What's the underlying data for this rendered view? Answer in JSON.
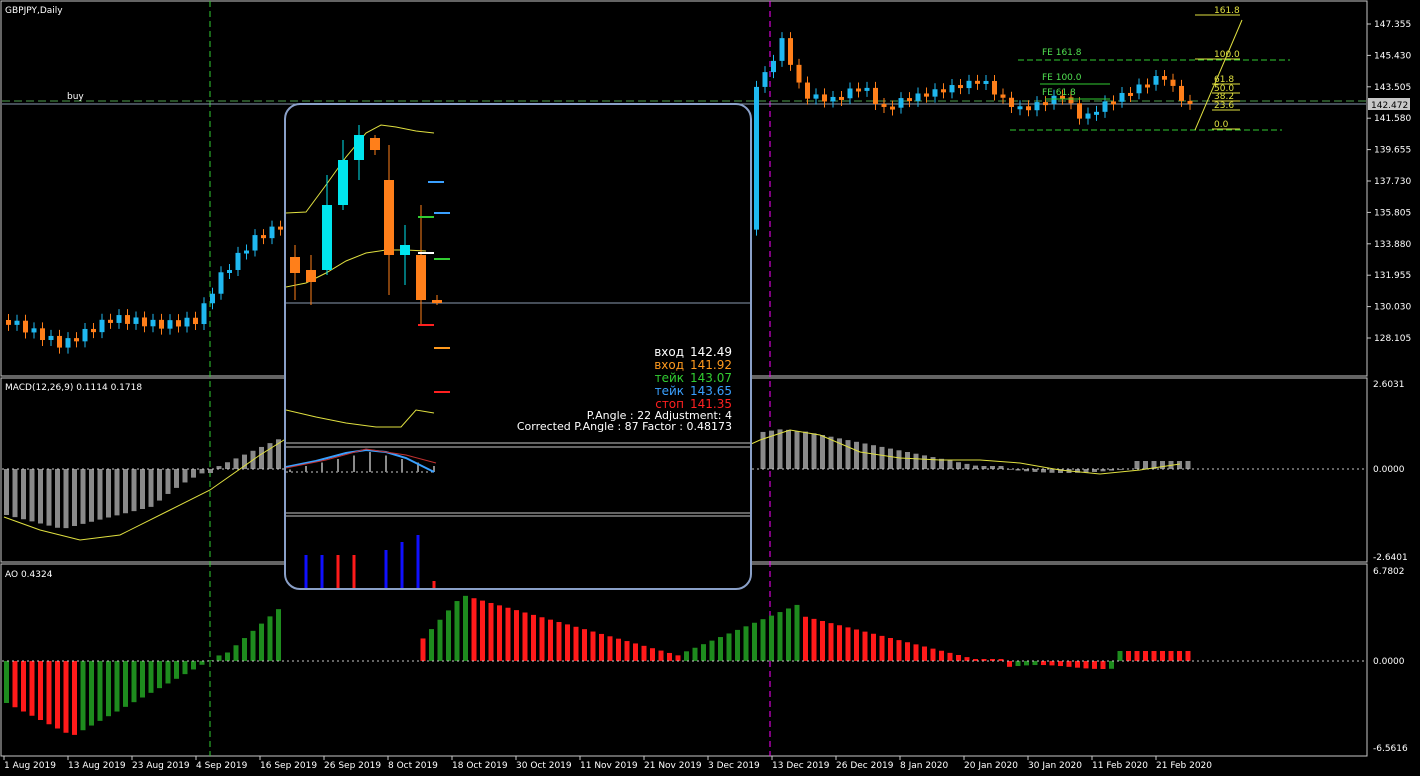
{
  "symbol_title": "GBPJPY,Daily",
  "buy_label": "buy",
  "price_axis": [
    "147.355",
    "145.430",
    "143.505",
    "141.580",
    "139.655",
    "137.730",
    "135.805",
    "133.880",
    "131.955",
    "130.030",
    "128.105"
  ],
  "current_price": "142.472",
  "macd": {
    "label": "MACD(12,26,9) 0.1114 0.1718",
    "axis_top": "2.6031",
    "axis_zero": "0.0000",
    "axis_bottom": "-2.6401"
  },
  "ao": {
    "label": "AO 0.4324",
    "axis_top": "6.7802",
    "axis_zero": "0.0000",
    "axis_bottom": "-6.5616"
  },
  "dates": [
    "1 Aug 2019",
    "13 Aug 2019",
    "23 Aug 2019",
    "4 Sep 2019",
    "16 Sep 2019",
    "26 Sep 2019",
    "8 Oct 2019",
    "18 Oct 2019",
    "30 Oct 2019",
    "11 Nov 2019",
    "21 Nov 2019",
    "3 Dec 2019",
    "13 Dec 2019",
    "26 Dec 2019",
    "8 Jan 2020",
    "20 Jan 2020",
    "30 Jan 2020",
    "11 Feb 2020",
    "21 Feb 2020"
  ],
  "fibo": {
    "fe_labels": [
      "FE 161.8",
      "FE 100.0",
      "FE 61.8"
    ],
    "levels": [
      "161.8",
      "100.0",
      "61.8",
      "50.0",
      "38.2",
      "23.6",
      "0.0"
    ]
  },
  "panel": {
    "lines": [
      {
        "label": "вход",
        "value": "142.49",
        "color": "#ffffff"
      },
      {
        "label": "вход",
        "value": "141.92",
        "color": "#ff9a1e"
      },
      {
        "label": "тейк",
        "value": "143.07",
        "color": "#32cd32"
      },
      {
        "label": "тейк",
        "value": "143.65",
        "color": "#3aa0ff"
      },
      {
        "label": "стоп",
        "value": "141.35",
        "color": "#ff2020"
      }
    ],
    "angle_line": "P.Angle : 22   Adjustment: 4",
    "corrected_line": "Corrected P.Angle : 87   Factor : 0.48173"
  },
  "colors": {
    "bull": "#1fb8f0",
    "bear": "#ff7f1a",
    "ao_up": "#1e8c1e",
    "ao_down": "#ff1a1a",
    "macd_hist": "#8a8a8a",
    "signal": "#e0e040"
  }
}
